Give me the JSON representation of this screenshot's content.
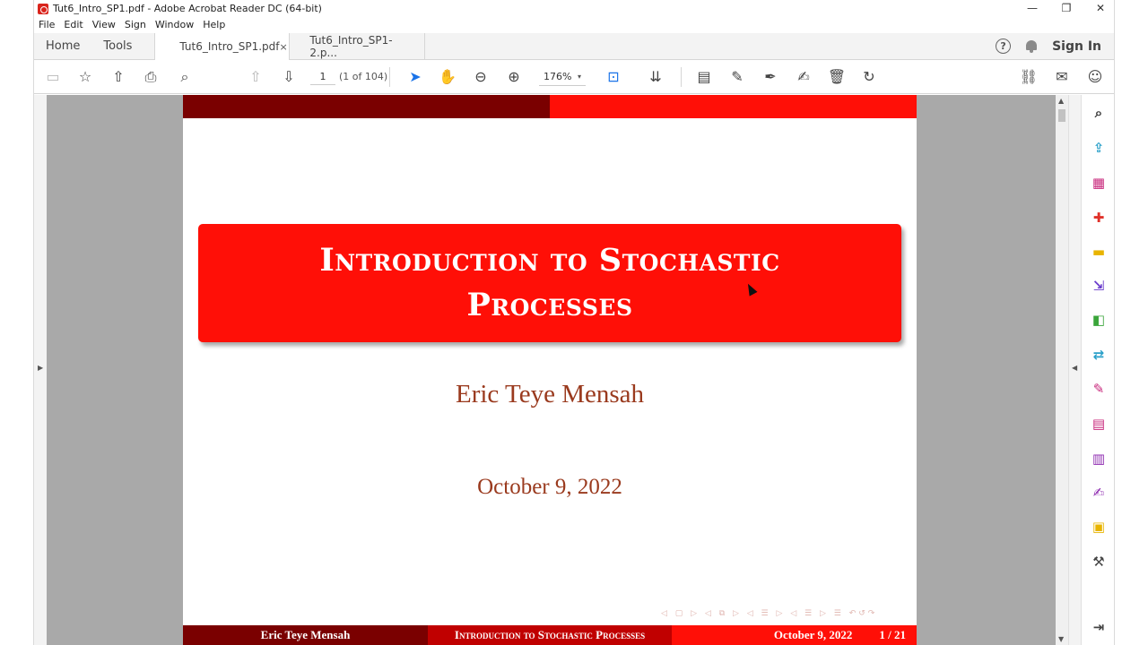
{
  "window": {
    "title": "Tut6_Intro_SP1.pdf - Adobe Acrobat Reader DC (64-bit)",
    "minimize": "—",
    "restore": "❐",
    "close": "✕"
  },
  "menu": [
    "File",
    "Edit",
    "View",
    "Sign",
    "Window",
    "Help"
  ],
  "tabs": {
    "home": "Home",
    "tools": "Tools",
    "docs": [
      {
        "label": "Tut6_Intro_SP1.pdf",
        "close": "×"
      },
      {
        "label": "Tut6_Intro_SP1-2.p..."
      }
    ],
    "help": "?",
    "sign_in": "Sign In"
  },
  "toolbar": {
    "page_number": "1",
    "page_of": "(1 of 104)",
    "zoom": "176%",
    "zoom_arrow": "▾"
  },
  "icons": {
    "save": "▭",
    "star": "☆",
    "upload": "⇧",
    "print": "⎙",
    "search": "⌕",
    "prev_page": "⇧",
    "next_page": "⇩",
    "select": "➤",
    "hand": "✋",
    "zoom_out": "⊖",
    "zoom_in": "⊕",
    "fit": "⊡",
    "scroll": "⇊",
    "comment": "▤",
    "highlight": "✎",
    "draw": "✒",
    "sign": "✍",
    "delete": "🗑",
    "rotate": "↻",
    "link": "⛓",
    "mail": "✉",
    "user": "☺",
    "scroll_up": "▲",
    "scroll_down": "▼",
    "collapse_left": "▶",
    "collapse_right": "◀",
    "rp_zoom": "⌕",
    "rp_export": "⇪",
    "rp_organize": "▦",
    "rp_create": "✚",
    "rp_comment": "▬",
    "rp_combine": "⇲",
    "rp_compress": "◧",
    "rp_send": "⇄",
    "rp_fill": "✎",
    "rp_pdf": "▤",
    "rp_protect": "▥",
    "rp_sign": "✍",
    "rp_more": "▣",
    "rp_tools": "⚒",
    "rp_pin": "⇥"
  },
  "colors": {
    "accent_dark": "#7a0000",
    "accent_red": "#ff0f07",
    "text_brown": "#9a3a1e"
  },
  "slide": {
    "title": "Introduction to Stochastic Processes",
    "author": "Eric Teye Mensah",
    "date": "October 9, 2022",
    "nav_symbols": "◁ ▢ ▷ ◁ ⧉ ▷ ◁ ☰ ▷ ◁ ☰ ▷ ☰ ↶↺↷",
    "footer_author": "Eric Teye Mensah",
    "footer_title": "Introduction to Stochastic Processes",
    "footer_date": "October 9, 2022",
    "footer_page": "1 / 21"
  }
}
